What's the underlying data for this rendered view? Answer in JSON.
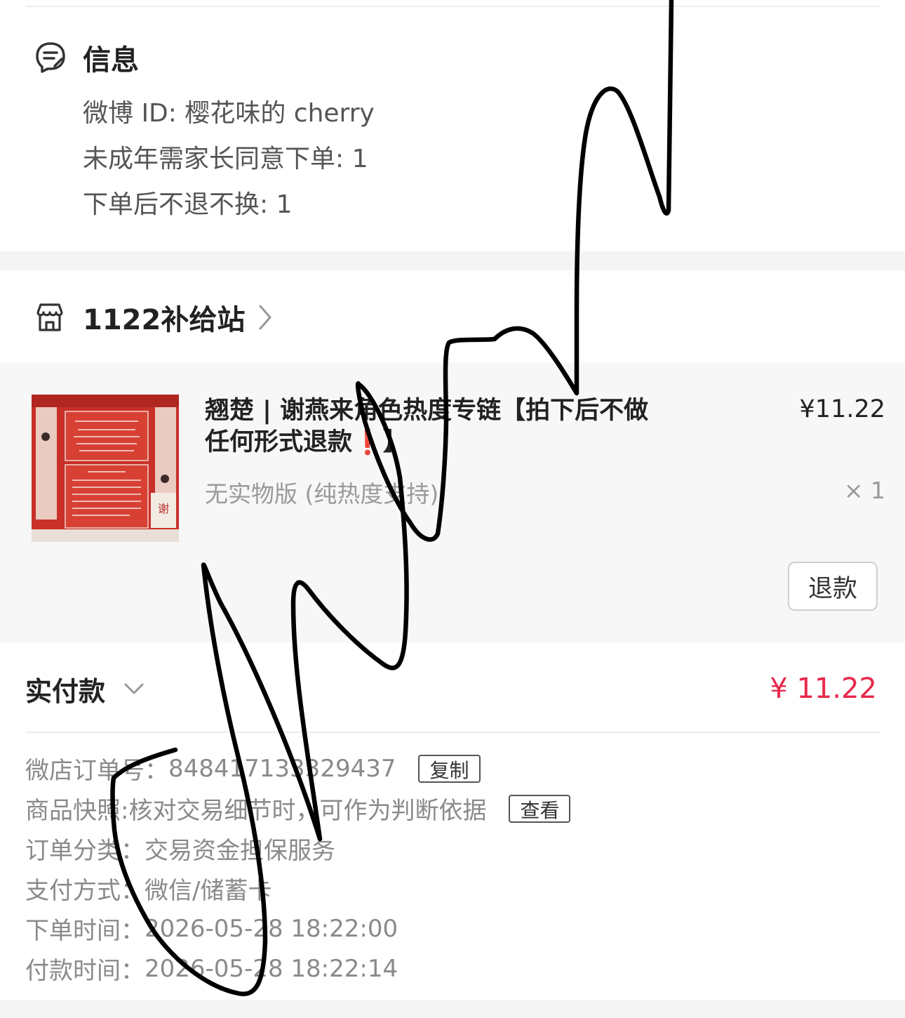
{
  "info": {
    "title": "信息",
    "icon": "message-note-icon",
    "lines": [
      "微博 ID: 樱花味的 cherry",
      "未成年需家长同意下单: 1",
      "下单后不退不换: 1"
    ]
  },
  "shop": {
    "name": "1122补给站",
    "icon": "store-icon"
  },
  "product": {
    "title": "翘楚 | 谢燕来角色热度专链【拍下后不做任何形式退款",
    "title_exclaim": "❗",
    "title_end": "】",
    "variant": "无实物版 (纯热度支持)",
    "price": "¥11.22",
    "quantity": "× 1",
    "refund_label": "退款"
  },
  "payment": {
    "label": "实付款",
    "amount": "¥ 11.22",
    "amount_color": "#e8284a"
  },
  "order": {
    "rows": [
      {
        "label": "微店订单号：",
        "value": "848417133329437",
        "button": "复制"
      },
      {
        "label": "商品快照: ",
        "value": "核对交易细节时，可作为判断依据",
        "button": "查看"
      },
      {
        "label": "订单分类：",
        "value": "交易资金担保服务"
      },
      {
        "label": "支付方式：",
        "value": "微信/储蓄卡"
      },
      {
        "label": "下单时间：",
        "value": "2026-05-28 18:22:00"
      },
      {
        "label": "付款时间：",
        "value": "2026-05-28 18:22:14"
      }
    ]
  }
}
